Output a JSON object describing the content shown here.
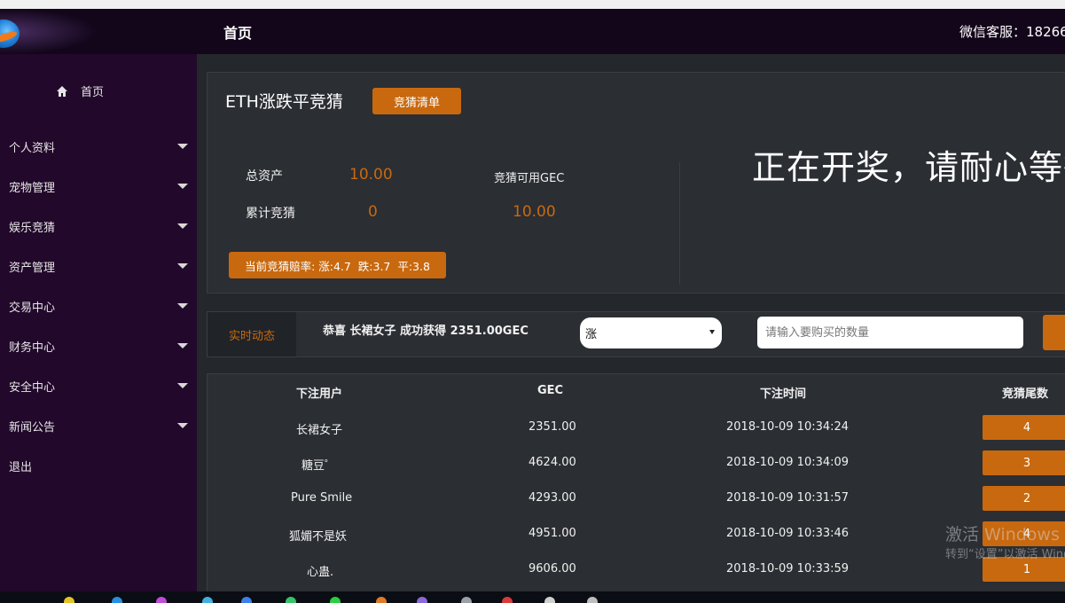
{
  "header": {
    "title": "首页",
    "service": "微信客服：18266"
  },
  "sidebar": {
    "home": "首页",
    "items": [
      {
        "label": "个人资料"
      },
      {
        "label": "宠物管理"
      },
      {
        "label": "娱乐竞猜"
      },
      {
        "label": "资产管理"
      },
      {
        "label": "交易中心"
      },
      {
        "label": "财务中心"
      },
      {
        "label": "安全中心"
      },
      {
        "label": "新闻公告"
      },
      {
        "label": "退出"
      }
    ]
  },
  "game": {
    "title": "ETH涨跌平竞猜",
    "list_button": "竞猜清单",
    "total_assets_label": "总资产",
    "total_assets_value": "10.00",
    "cumulative_label": "累计竞猜",
    "cumulative_value": "0",
    "available_label": "竞猜可用GEC",
    "available_value": "10.00",
    "odds": "当前竞猜赔率: 涨:4.7  跌:3.7  平:3.8",
    "status_message": "正在开奖，请耐心等待"
  },
  "dynamic": {
    "label": "实时动态",
    "message": "恭喜 长裙女子 成功获得 2351.00GEC",
    "select_value": "涨",
    "quantity_placeholder": "请输入要购买的数量"
  },
  "table": {
    "headers": [
      "下注用户",
      "GEC",
      "下注时间",
      "竞猜尾数"
    ],
    "rows": [
      {
        "user": "长裙女子",
        "gec": "2351.00",
        "time": "2018-10-09 10:34:24",
        "tail": "4"
      },
      {
        "user": "糖豆゜",
        "gec": "4624.00",
        "time": "2018-10-09 10:34:09",
        "tail": "3"
      },
      {
        "user": "Pure Smile",
        "gec": "4293.00",
        "time": "2018-10-09 10:31:57",
        "tail": "2"
      },
      {
        "user": "狐媚不是妖",
        "gec": "4951.00",
        "time": "2018-10-09 10:33:46",
        "tail": "4"
      },
      {
        "user": "心蛊.",
        "gec": "9606.00",
        "time": "2018-10-09 10:33:59",
        "tail": "1"
      }
    ]
  },
  "watermark": {
    "line1": "激活 Windows",
    "line2": "转到“设置”以激活 Windows。"
  },
  "colors": {
    "accent": "#c8690f",
    "sidebar": "#22082b",
    "header": "#13061a",
    "content": "#24272b"
  }
}
